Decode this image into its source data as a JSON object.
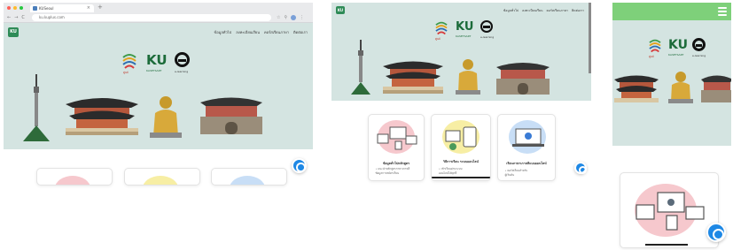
{
  "browser": {
    "tab_title": "KUSeoul",
    "url": "ku.kuplus.com",
    "new_tab_symbol": "+",
    "tab_close_symbol": "×",
    "nav_back": "←",
    "nav_forward": "→",
    "nav_reload": "C"
  },
  "site": {
    "logo_text": "KU",
    "nav_items": [
      "ข้อมูลทั่วไป",
      "ลงทะเบียนเรียน",
      "คอร์สเรียนภาษา",
      "ติดต่อเรา"
    ],
    "brand_ku": "KU",
    "brand_e": "e",
    "flower_caption": "ศูนย์",
    "ku_caption": "KASETSART",
    "e_caption": "e-learning"
  },
  "cards": [
    {
      "title": "ข้อมูลทั่วไปหลักสูตร",
      "lines": [
        "• แนะนำหลักสูตรภาษาเกาหลี",
        "  ข้อมูลการสมัครเรียน"
      ]
    },
    {
      "title": "วิธีการเรียน ระบบออนไลน์",
      "lines": [
        "• เข้าเรียนผ่านระบบ",
        "  ออนไลน์ได้ทุกที่"
      ]
    },
    {
      "title": "เรียนภาษาเกาหลีแบบออนไลน์",
      "lines": [
        "• คอร์สเรียนสำหรับ",
        "  ผู้เริ่มต้น"
      ]
    }
  ],
  "colors": {
    "hero_bg": "#d4e4e1",
    "mobile_bar": "#7ed07a",
    "messenger": "#1e88e5",
    "ku_green": "#1c6b3a"
  },
  "icons": {
    "messenger": "messenger-icon",
    "menu": "hamburger-menu-icon",
    "logo": "ku-logo-icon"
  }
}
